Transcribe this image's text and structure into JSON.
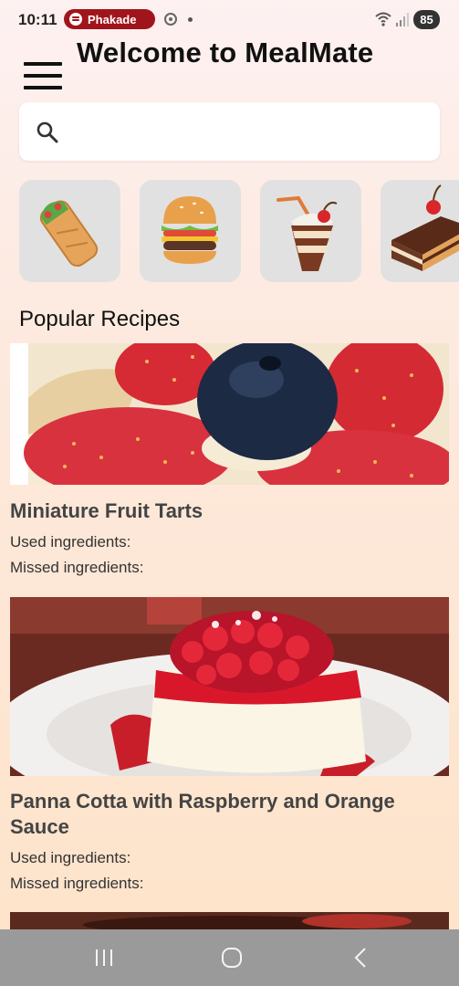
{
  "status_bar": {
    "time": "10:11",
    "media_app": "Phakade",
    "battery": "85"
  },
  "header": {
    "title": "Welcome to MealMate"
  },
  "search": {
    "placeholder": "",
    "value": ""
  },
  "categories": [
    {
      "icon": "wrap-icon"
    },
    {
      "icon": "burger-icon"
    },
    {
      "icon": "milkshake-icon"
    },
    {
      "icon": "cake-icon"
    }
  ],
  "section": {
    "title": "Popular Recipes"
  },
  "recipes": [
    {
      "name": "Miniature Fruit Tarts",
      "used_label": "Used ingredients:",
      "missed_label": "Missed ingredients:"
    },
    {
      "name": "Panna Cotta with Raspberry and Orange Sauce",
      "used_label": "Used ingredients:",
      "missed_label": "Missed ingredients:"
    }
  ],
  "colors": {
    "spotify_pill": "#a0151b",
    "nav_bar": "#9a9a9a",
    "title_text": "#111111",
    "recipe_name": "#444444"
  }
}
